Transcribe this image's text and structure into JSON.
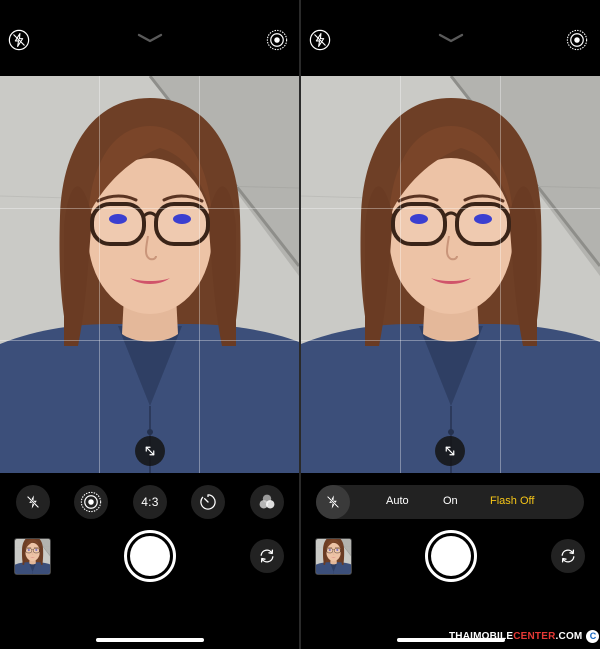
{
  "left_screen": {
    "top_bar": {
      "flash_icon": "flash-off-icon",
      "chevron_icon": "chevron-down-icon",
      "live_icon": "live-photo-icon"
    },
    "controls": {
      "flash_icon": "flash-off-icon",
      "live_icon": "live-photo-icon",
      "aspect_label": "4:3",
      "timer_icon": "timer-icon",
      "filters_icon": "filters-icon"
    },
    "zoom_icon": "expand-arrows-icon",
    "thumbnail_icon": "last-photo-thumbnail",
    "flip_icon": "camera-flip-icon"
  },
  "right_screen": {
    "top_bar": {
      "flash_icon": "flash-off-icon",
      "chevron_icon": "chevron-down-icon",
      "live_icon": "live-photo-icon"
    },
    "flash_menu": {
      "icon": "flash-off-icon",
      "options": [
        "Auto",
        "On",
        "Flash Off"
      ],
      "selected": "Flash Off",
      "selected_color": "#f5c518"
    },
    "zoom_icon": "expand-arrows-icon",
    "thumbnail_icon": "last-photo-thumbnail",
    "flip_icon": "camera-flip-icon"
  },
  "watermark": {
    "prefix": "THAIMOBILE",
    "accent": "CENTER",
    "suffix": ".COM",
    "badge": "C",
    "accent_color": "#e53935"
  }
}
